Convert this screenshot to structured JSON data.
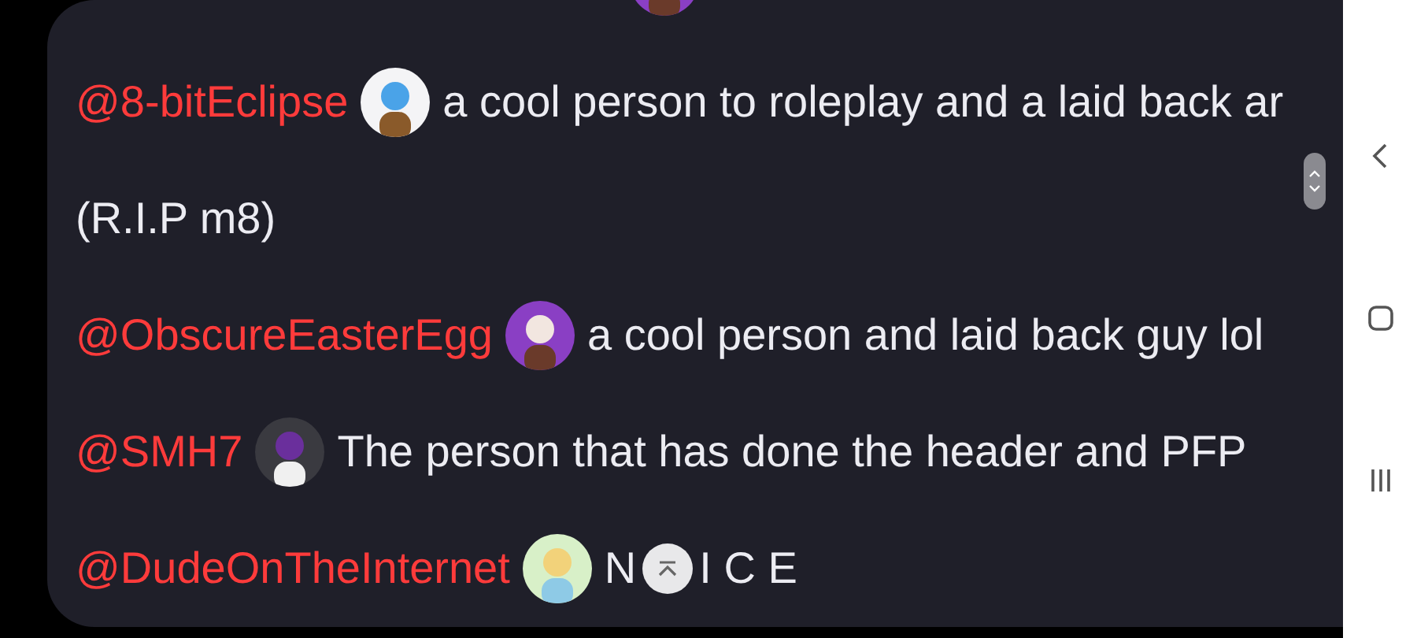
{
  "lines": [
    {
      "kind": "mention",
      "username": "@8-bitEclipse",
      "text": "a cool person to roleplay and a laid back ar"
    },
    {
      "kind": "text",
      "text": "(R.I.P m8)"
    },
    {
      "kind": "mention",
      "username": "@ObscureEasterEgg",
      "text": "a cool person and laid back guy lol"
    },
    {
      "kind": "mention",
      "username": "@SMH7",
      "text": "The person that has done the header and PFP"
    },
    {
      "kind": "mention",
      "username": "@DudeOnTheInternet",
      "text": "N",
      "text_after": "I C E"
    }
  ]
}
